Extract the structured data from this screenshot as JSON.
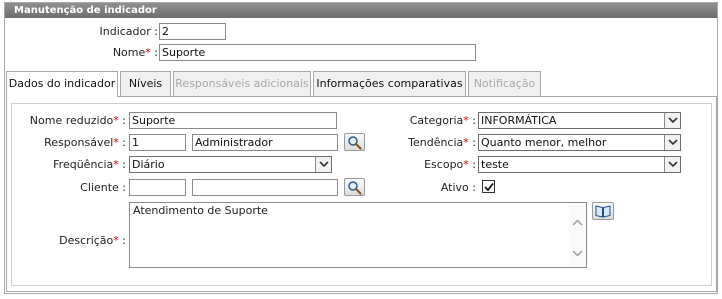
{
  "panel": {
    "title": "Manutenção de indicador"
  },
  "header_fields": {
    "indicador": {
      "label": "Indicador",
      "value": "2"
    },
    "nome": {
      "label": "Nome",
      "value": "Suporte"
    }
  },
  "tabs": [
    {
      "label": "Dados do indicador",
      "state": "active"
    },
    {
      "label": "Níveis",
      "state": "normal"
    },
    {
      "label": "Responsáveis adicionais",
      "state": "disabled"
    },
    {
      "label": "Informações comparativas",
      "state": "normal"
    },
    {
      "label": "Notificação",
      "state": "disabled"
    }
  ],
  "form": {
    "nome_reduzido": {
      "label": "Nome reduzido",
      "value": "Suporte"
    },
    "responsavel": {
      "label": "Responsável",
      "code": "1",
      "name": "Administrador"
    },
    "frequencia": {
      "label": "Freqüência",
      "value": "Diário"
    },
    "cliente": {
      "label": "Cliente",
      "code": "",
      "name": ""
    },
    "descricao": {
      "label": "Descrição",
      "value": "Atendimento de Suporte"
    },
    "categoria": {
      "label": "Categoria",
      "value": "INFORMÁTICA"
    },
    "tendencia": {
      "label": "Tendência",
      "value": "Quanto menor, melhor"
    },
    "escopo": {
      "label": "Escopo",
      "value": "teste"
    },
    "ativo": {
      "label": "Ativo",
      "checked": true
    }
  },
  "symbols": {
    "required": "*",
    "colon": ":"
  },
  "icons": [
    "search-icon",
    "book-icon",
    "checkmark-icon",
    "chevron-down-icon",
    "scroll-up-icon",
    "scroll-down-icon"
  ],
  "colors": {
    "header_bg": "#7d7d7d",
    "required": "#cc0000",
    "border": "#a8a8a8",
    "disabled_tab_text": "#a8a8a8"
  }
}
